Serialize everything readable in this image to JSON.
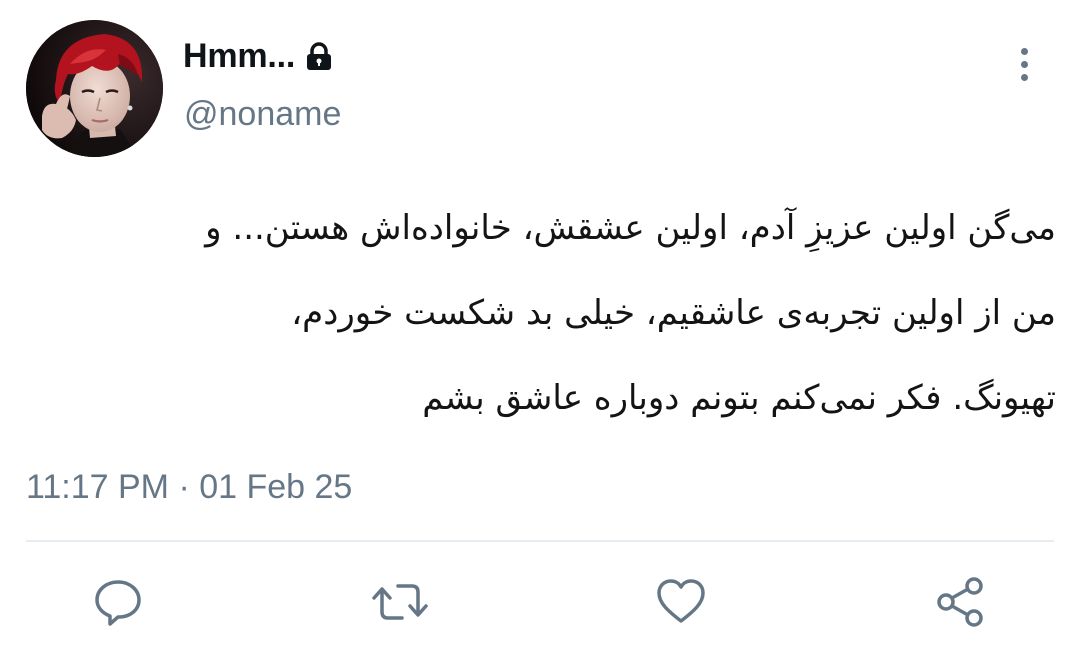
{
  "author": {
    "display_name": "Hmm...",
    "handle": "@noname",
    "protected": true,
    "avatar_icon": "profile-photo"
  },
  "menu": {
    "more_icon": "vertical-ellipsis-icon"
  },
  "tweet": {
    "direction": "rtl",
    "lines": [
      "می‌گن اولین عزیزِ آدم، اولین عشقش، خانواده‌اش هستن... و",
      "من از اولین تجربه‌ی عاشقیم، خیلی بد شکست خوردم،",
      "تهیونگ. فکر نمی‌کنم بتونم دوباره عاشق بشم"
    ],
    "timestamp": "11:17 PM · 01 Feb 25"
  },
  "actions": [
    {
      "name": "reply",
      "icon": "comment-icon"
    },
    {
      "name": "retweet",
      "icon": "retweet-icon"
    },
    {
      "name": "like",
      "icon": "heart-icon"
    },
    {
      "name": "share",
      "icon": "share-icon"
    }
  ],
  "colors": {
    "text": "#0f1419",
    "secondary": "#657786",
    "divider": "#e6ecf0",
    "avatar_hair": "#b3121f"
  }
}
